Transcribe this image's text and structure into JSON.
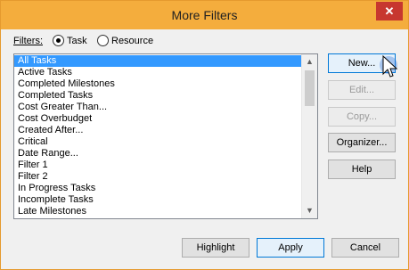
{
  "window": {
    "title": "More Filters",
    "close_glyph": "✕"
  },
  "filters": {
    "label": "Filters:",
    "options": [
      {
        "label": "Task",
        "selected": true
      },
      {
        "label": "Resource",
        "selected": false
      }
    ]
  },
  "list": {
    "items": [
      "All Tasks",
      "Active Tasks",
      "Completed Milestones",
      "Completed Tasks",
      "Cost Greater Than...",
      "Cost Overbudget",
      "Created After...",
      "Critical",
      "Date Range...",
      "Filter 1",
      "Filter 2",
      "In Progress Tasks",
      "Incomplete Tasks",
      "Late Milestones"
    ],
    "selected_index": 0
  },
  "side_buttons": {
    "new": "New...",
    "edit": "Edit...",
    "copy": "Copy...",
    "organizer": "Organizer...",
    "help": "Help"
  },
  "bottom_buttons": {
    "highlight": "Highlight",
    "apply": "Apply",
    "cancel": "Cancel"
  },
  "colors": {
    "titlebar": "#f4ad3d",
    "close": "#c7372f",
    "selection": "#3399ff"
  }
}
